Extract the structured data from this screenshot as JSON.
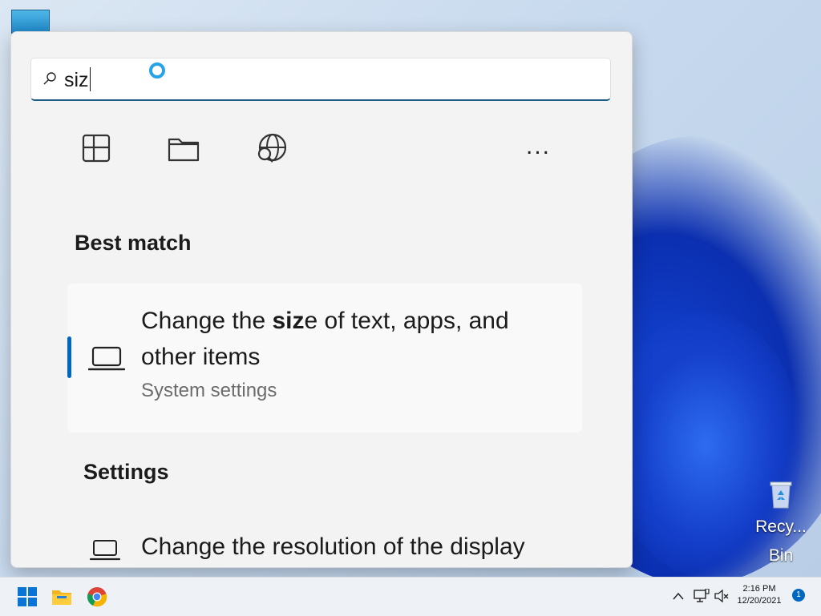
{
  "search": {
    "value": "siz"
  },
  "filters": {
    "apps_icon": "apps-grid-icon",
    "documents_icon": "folder-icon",
    "web_icon": "globe-search-icon",
    "more_label": "..."
  },
  "best_match": {
    "heading": "Best match",
    "title_before": "Change the ",
    "title_bold": "siz",
    "title_after": "e of text, apps, and other items",
    "subtitle": "System settings",
    "icon": "laptop-icon"
  },
  "settings": {
    "heading": "Settings",
    "items": [
      {
        "label": "Change the resolution of the display",
        "icon": "laptop-icon"
      }
    ]
  },
  "desktop": {
    "recycle_bin_label": "Recy... Bin"
  },
  "taskbar": {
    "clock_time": "2:16 PM",
    "clock_date": "12/20/2021",
    "notification_count": "1",
    "accent_color": "#0067c0"
  }
}
